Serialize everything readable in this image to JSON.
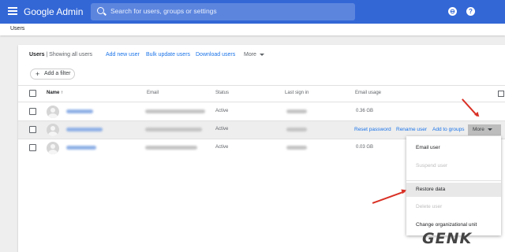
{
  "topbar": {
    "brand": "Google Admin",
    "search_placeholder": "Search for users, groups or settings",
    "help_icon": "?"
  },
  "breadcrumb": {
    "title": "Users"
  },
  "card": {
    "title": "Users",
    "subtitle": " | Showing all users",
    "actions": [
      "Add new user",
      "Bulk update users",
      "Download users"
    ],
    "more_label": "More",
    "filter_label": "Add a filter",
    "columns": [
      "Name",
      "Email",
      "Status",
      "Last sign in",
      "Email usage"
    ]
  },
  "rows": [
    {
      "status": "Active",
      "usage": "0.36 GB"
    },
    {
      "status": "Active",
      "usage": ""
    },
    {
      "status": "Active",
      "usage": "0.03 GB"
    }
  ],
  "row_actions": {
    "reset": "Reset password",
    "rename": "Rename user",
    "add_groups": "Add to groups",
    "more": "More"
  },
  "menu": {
    "items": [
      "Email user",
      "Suspend user",
      "Restore data",
      "Delete user",
      "Change organizational unit"
    ]
  },
  "watermark": {
    "text": "GENK"
  },
  "colors": {
    "brand_blue": "#3367d6",
    "link_blue": "#1a73e8",
    "annotation_red": "#d93025"
  }
}
